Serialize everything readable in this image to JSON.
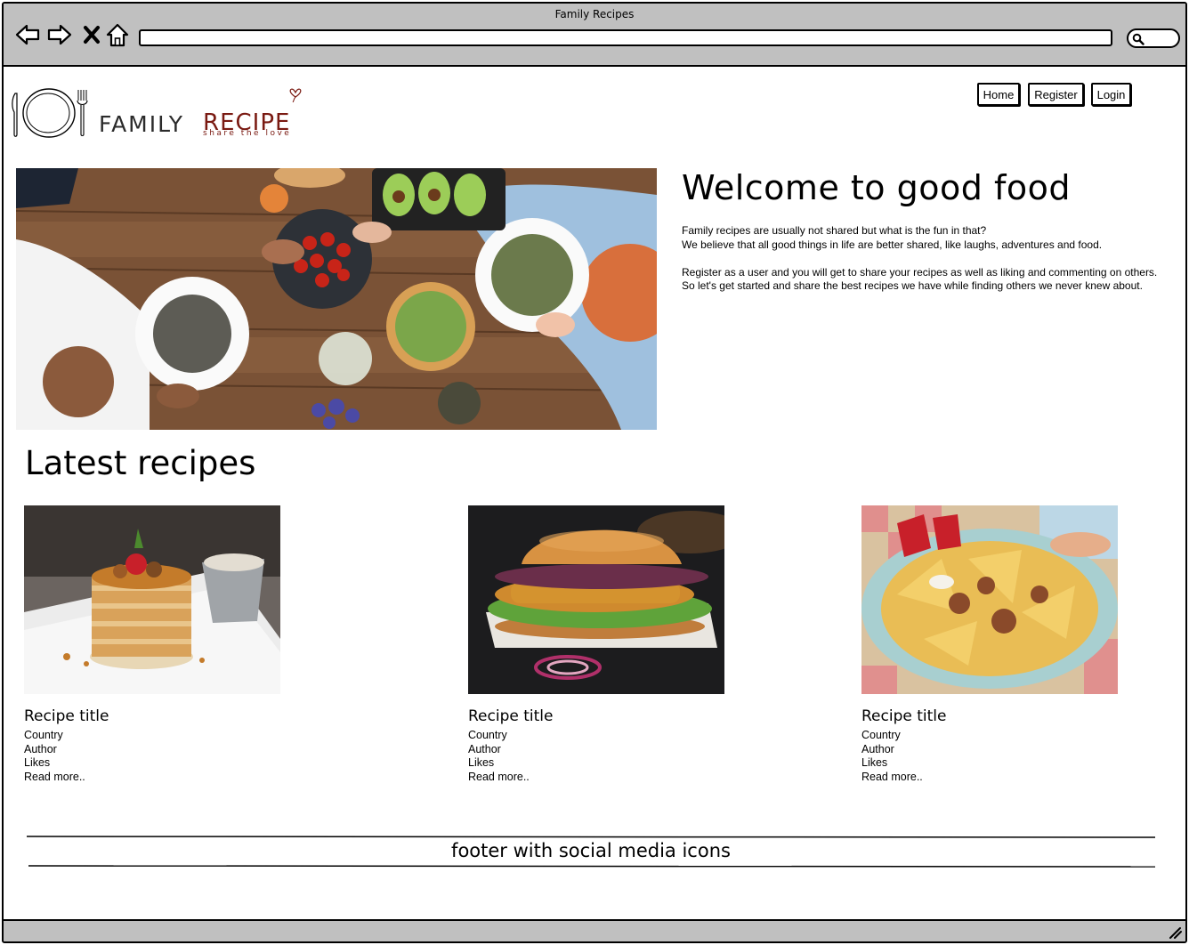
{
  "browser": {
    "window_title": "Family Recipes",
    "icons": [
      "back-arrow-icon",
      "forward-arrow-icon",
      "close-x-icon",
      "home-icon",
      "search-icon",
      "resize-grip-icon"
    ],
    "chrome_color": "#c0c0c0"
  },
  "logo": {
    "word1": "FAMILY",
    "word2": "RECIPE",
    "tagline": "share the love",
    "accent_color": "#7a1a12",
    "icons": [
      "plate-icon",
      "knife-icon",
      "fork-icon",
      "heart-icon"
    ]
  },
  "nav": {
    "items": [
      {
        "label": "Home"
      },
      {
        "label": "Register"
      },
      {
        "label": "Login"
      }
    ]
  },
  "hero": {
    "image": "people sharing a meal around a wooden table",
    "title": "Welcome to good food",
    "paragraphs": [
      "Family recipes are usually not shared but what is the fun in that?",
      "We believe that all good things in life are better shared, like laughs, adventures and food.",
      "",
      "Register as a user and you will get to share your recipes as well as liking and commenting on others.",
      "So let's get started and share the best recipes we have while finding others we never knew about."
    ]
  },
  "latest": {
    "title": "Latest recipes",
    "cards": [
      {
        "image": "pancake stack with berries",
        "title": "Recipe title",
        "country": "Country",
        "author": "Author",
        "likes": "Likes",
        "read_more": "Read more.."
      },
      {
        "image": "crispy chicken burger",
        "title": "Recipe title",
        "country": "Country",
        "author": "Author",
        "likes": "Likes",
        "read_more": "Read more.."
      },
      {
        "image": "loaded nachos plate",
        "title": "Recipe title",
        "country": "Country",
        "author": "Author",
        "likes": "Likes",
        "read_more": "Read more.."
      }
    ]
  },
  "footer": {
    "text": "footer with social media icons"
  }
}
